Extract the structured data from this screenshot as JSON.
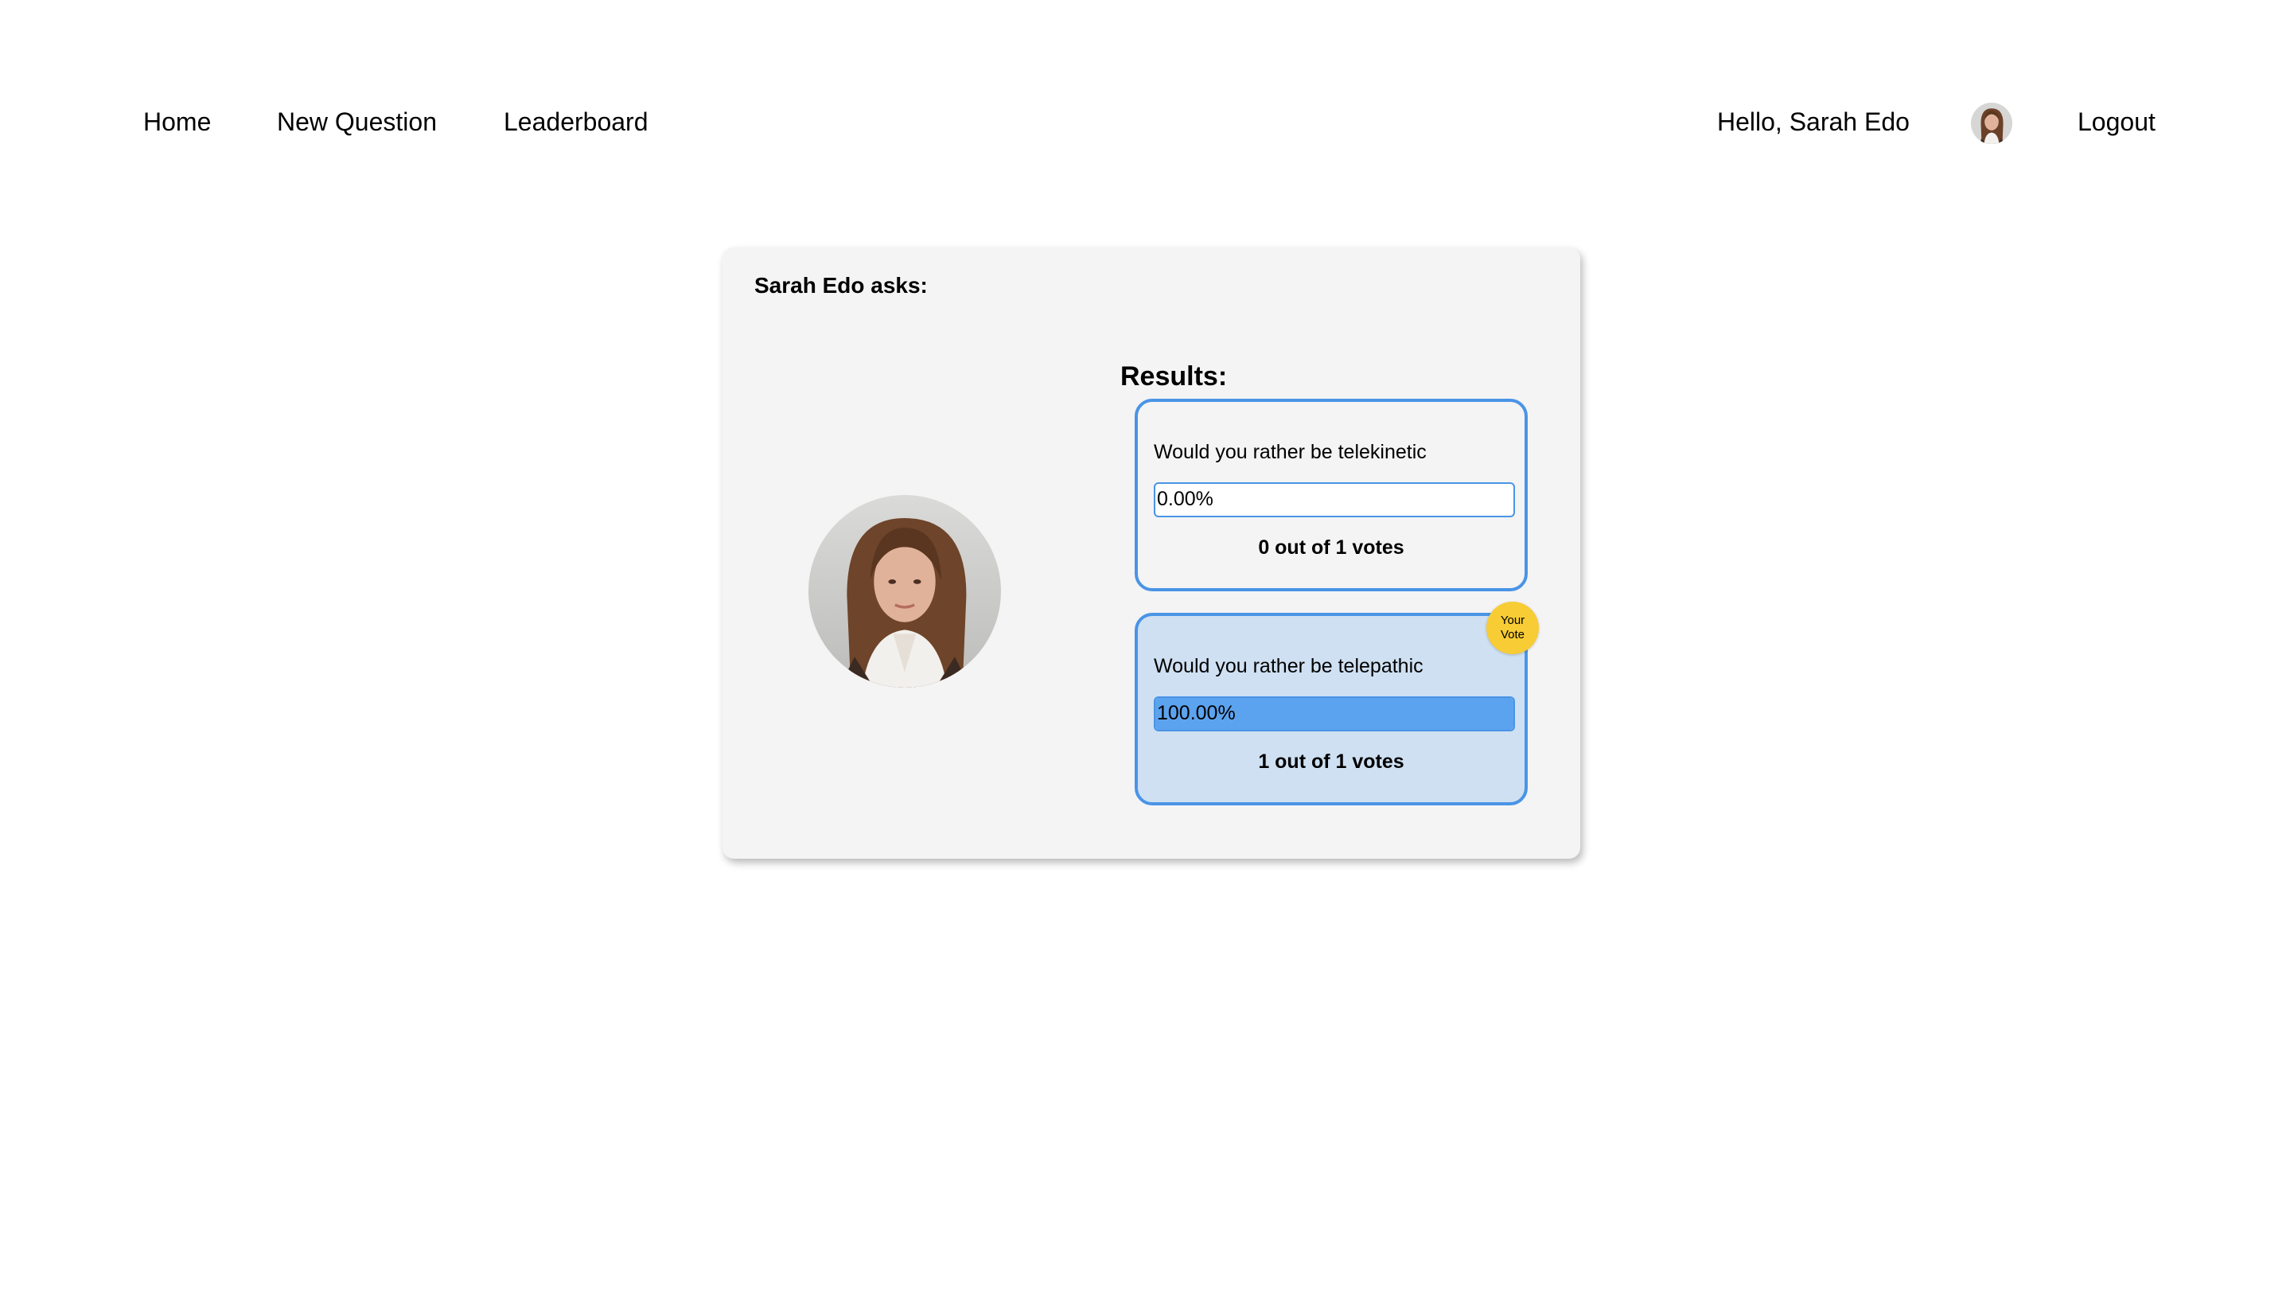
{
  "nav": {
    "home_label": "Home",
    "new_question_label": "New Question",
    "leaderboard_label": "Leaderboard",
    "greeting": "Hello, Sarah Edo",
    "logout_label": "Logout"
  },
  "poll": {
    "author_heading": "Sarah Edo asks:",
    "results_title": "Results:",
    "options": [
      {
        "text": "Would you rather be telekinetic",
        "percent_label": "0.00%",
        "fill_fraction": 0.0,
        "votes_label": "0 out of 1 votes",
        "your_vote": false
      },
      {
        "text": "Would you rather be telepathic",
        "percent_label": "100.00%",
        "fill_fraction": 1.0,
        "votes_label": "1 out of 1 votes",
        "your_vote": true
      }
    ],
    "your_vote_badge": {
      "line1": "Your",
      "line2": "Vote"
    }
  },
  "colors": {
    "accent_blue": "#4a94e6",
    "fill_blue": "#5ca3ef",
    "voted_bg": "#cfe0f2",
    "badge_yellow": "#f7cc35",
    "card_bg": "#f4f4f4"
  }
}
